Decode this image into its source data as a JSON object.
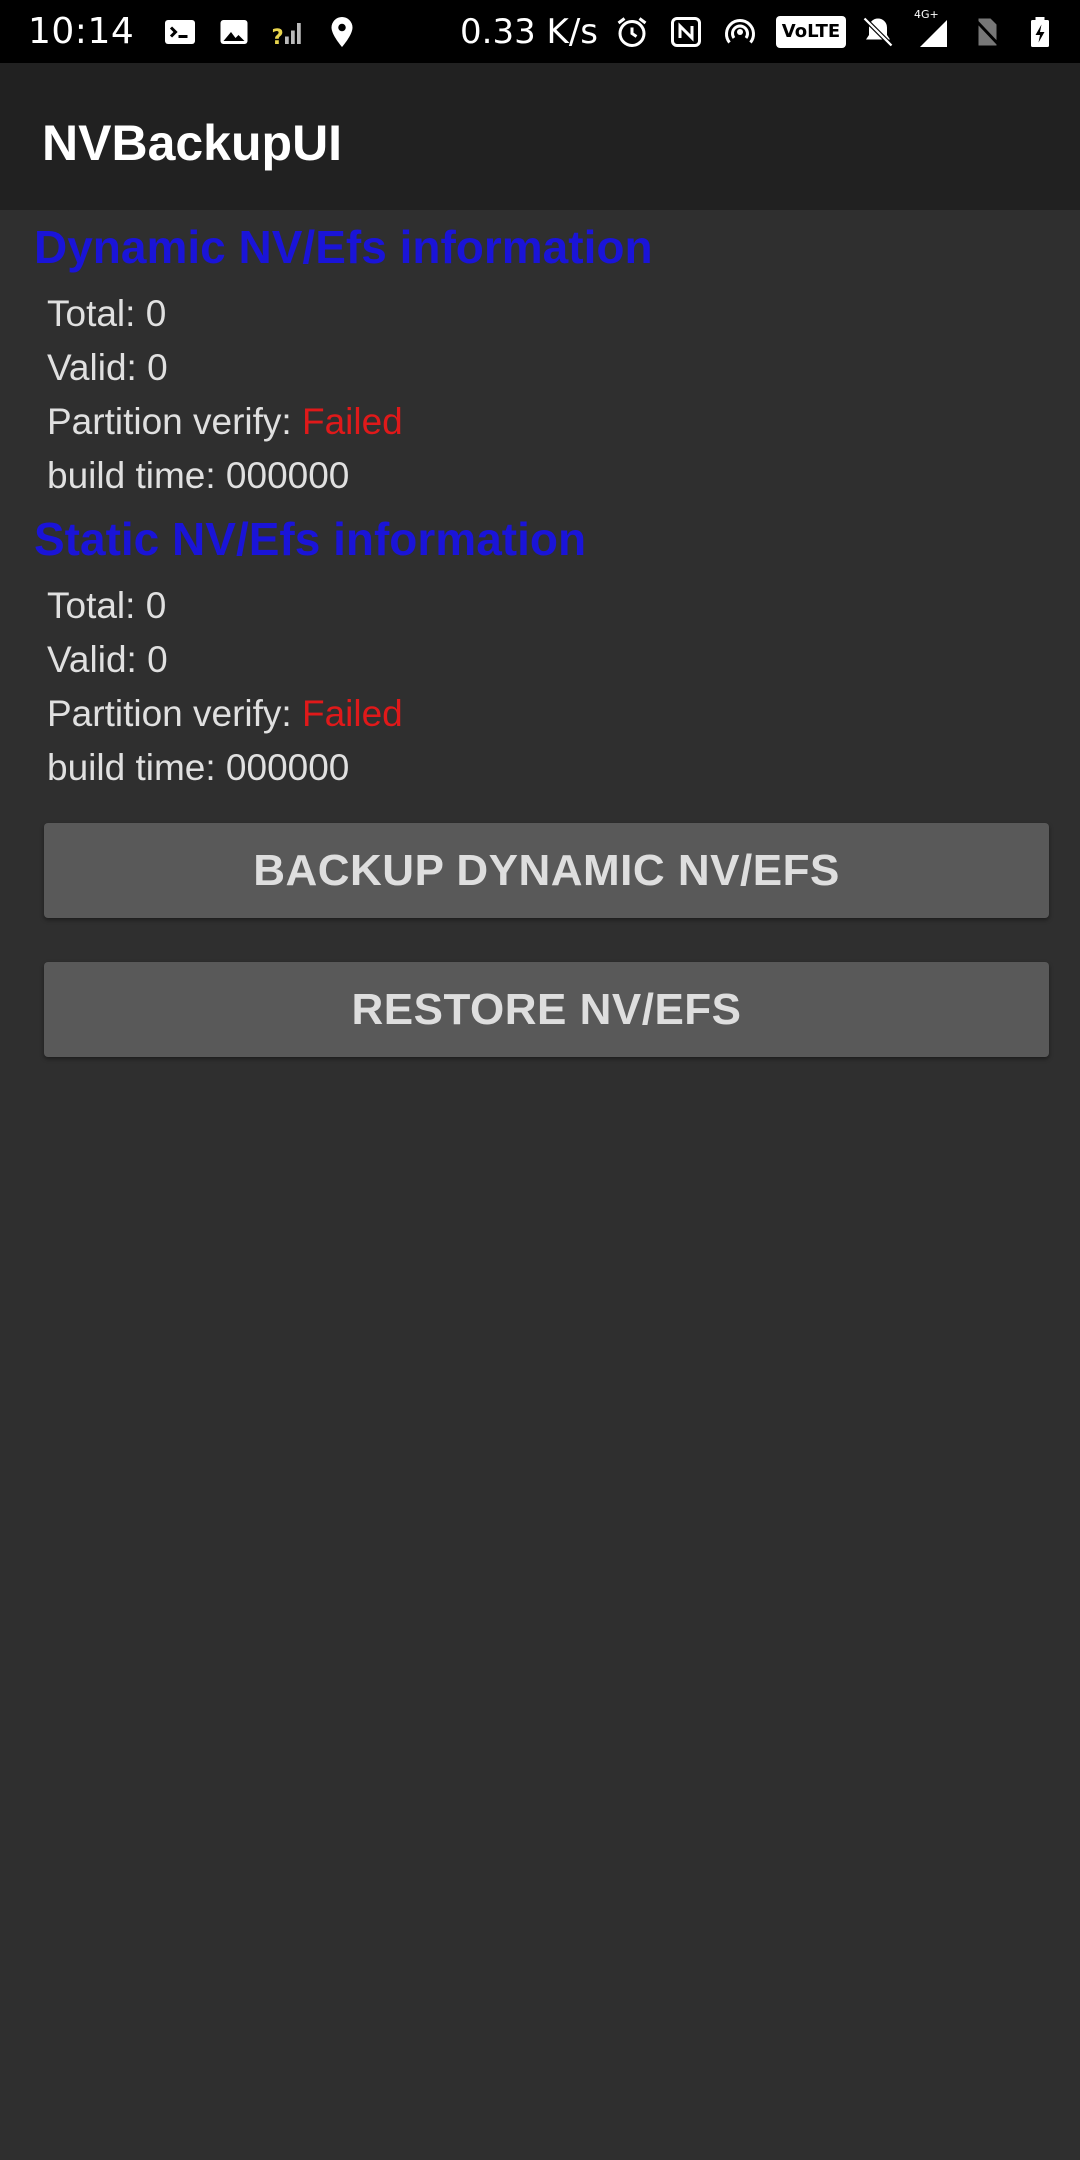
{
  "status_bar": {
    "time": "10:14",
    "net_speed": "0.33 K/s",
    "volte_label": "VoLTE",
    "network_label": "4G+",
    "icons": [
      "terminal-icon",
      "image-icon",
      "signal-unknown-icon",
      "location-icon",
      "alarm-icon",
      "nfc-icon",
      "hotspot-icon",
      "volte-icon",
      "bell-off-icon",
      "cell-signal-icon",
      "no-sim-icon",
      "battery-icon"
    ]
  },
  "app_bar": {
    "title": "NVBackupUI"
  },
  "dynamic": {
    "title": "Dynamic NV/Efs information",
    "total_label": "Total: ",
    "total": "0",
    "valid_label": "Valid: ",
    "valid": "0",
    "verify_label": "Partition verify: ",
    "verify_status": "Failed",
    "build_label": "build time: ",
    "build_time": "000000"
  },
  "static": {
    "title": "Static NV/Efs information",
    "total_label": "Total: ",
    "total": "0",
    "valid_label": "Valid: ",
    "valid": "0",
    "verify_label": "Partition verify: ",
    "verify_status": "Failed",
    "build_label": "build time: ",
    "build_time": "000000"
  },
  "buttons": {
    "backup": "BACKUP DYNAMIC NV/EFS",
    "restore": "RESTORE NV/EFS"
  },
  "colors": {
    "section_title": "#1a14d8",
    "failed": "#e0191a",
    "background": "#2f2f2f",
    "app_bar": "#212121",
    "button": "#595959"
  }
}
